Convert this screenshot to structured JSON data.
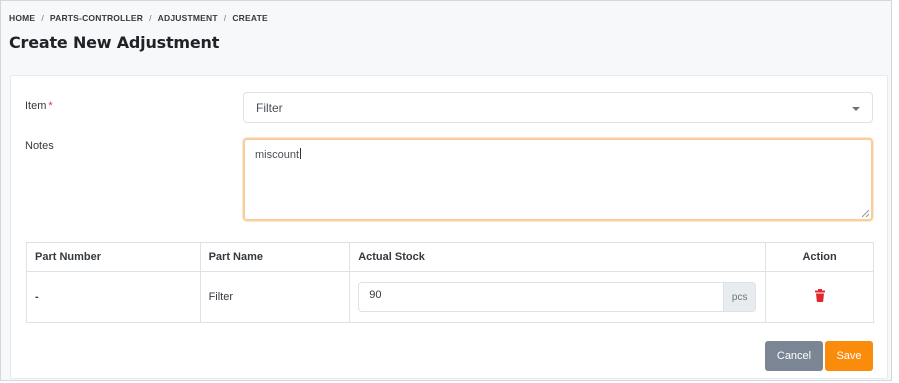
{
  "breadcrumb": [
    "HOME",
    "PARTS-CONTROLLER",
    "ADJUSTMENT",
    "CREATE"
  ],
  "page": {
    "title": "Create New Adjustment"
  },
  "form": {
    "item": {
      "label": "Item",
      "required_mark": "*",
      "value": "Filter"
    },
    "notes": {
      "label": "Notes",
      "value": "miscount"
    }
  },
  "table": {
    "headers": [
      "Part Number",
      "Part Name",
      "Actual Stock",
      "Action"
    ],
    "rows": [
      {
        "part_number": "-",
        "part_name": "Filter",
        "actual_stock": "90",
        "unit": "pcs",
        "action_icon": "trash-icon"
      }
    ]
  },
  "buttons": {
    "cancel": "Cancel",
    "save": "Save"
  },
  "colors": {
    "save": "#fb8c0b",
    "cancel": "#7b8593",
    "delete_icon": "#e3262e",
    "required": "#dc3545",
    "focus_border": "#f8cf9c"
  }
}
